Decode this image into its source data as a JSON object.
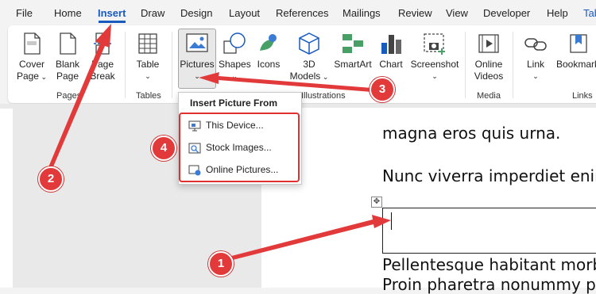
{
  "tabs": [
    {
      "label": "File",
      "active": false
    },
    {
      "label": "Home",
      "active": false
    },
    {
      "label": "Insert",
      "active": true
    },
    {
      "label": "Draw",
      "active": false
    },
    {
      "label": "Design",
      "active": false
    },
    {
      "label": "Layout",
      "active": false
    },
    {
      "label": "References",
      "active": false
    },
    {
      "label": "Mailings",
      "active": false
    },
    {
      "label": "Review",
      "active": false
    },
    {
      "label": "View",
      "active": false
    },
    {
      "label": "Developer",
      "active": false
    },
    {
      "label": "Help",
      "active": false
    },
    {
      "label": "Tab",
      "active": false
    }
  ],
  "ribbon": {
    "cover_page": [
      "Cover",
      "Page"
    ],
    "blank_page": [
      "Blank",
      "Page"
    ],
    "page_break": [
      "Page",
      "Break"
    ],
    "table": "Table",
    "pictures": "Pictures",
    "shapes": "Shapes",
    "icons": "Icons",
    "models_3d": [
      "3D",
      "Models"
    ],
    "smartart": "SmartArt",
    "chart": "Chart",
    "screenshot": "Screenshot",
    "online_videos": [
      "Online",
      "Videos"
    ],
    "link": "Link",
    "bookmark": "Bookmark",
    "groups": {
      "pages": "Pages",
      "tables": "Tables",
      "illustrations": "Illustrations",
      "media": "Media",
      "links": "Links"
    }
  },
  "dropdown": {
    "title": "Insert Picture From",
    "items": [
      "This Device...",
      "Stock Images...",
      "Online Pictures..."
    ]
  },
  "document": {
    "lines": [
      "magna eros quis urna.",
      "Nunc viverra imperdiet enim",
      "Pellentesque habitant morb",
      "Proin pharetra nonummy pe"
    ]
  },
  "callouts": [
    "1",
    "2",
    "3",
    "4"
  ],
  "colors": {
    "accent": "#185abd",
    "annotation": "#e23a3a"
  }
}
